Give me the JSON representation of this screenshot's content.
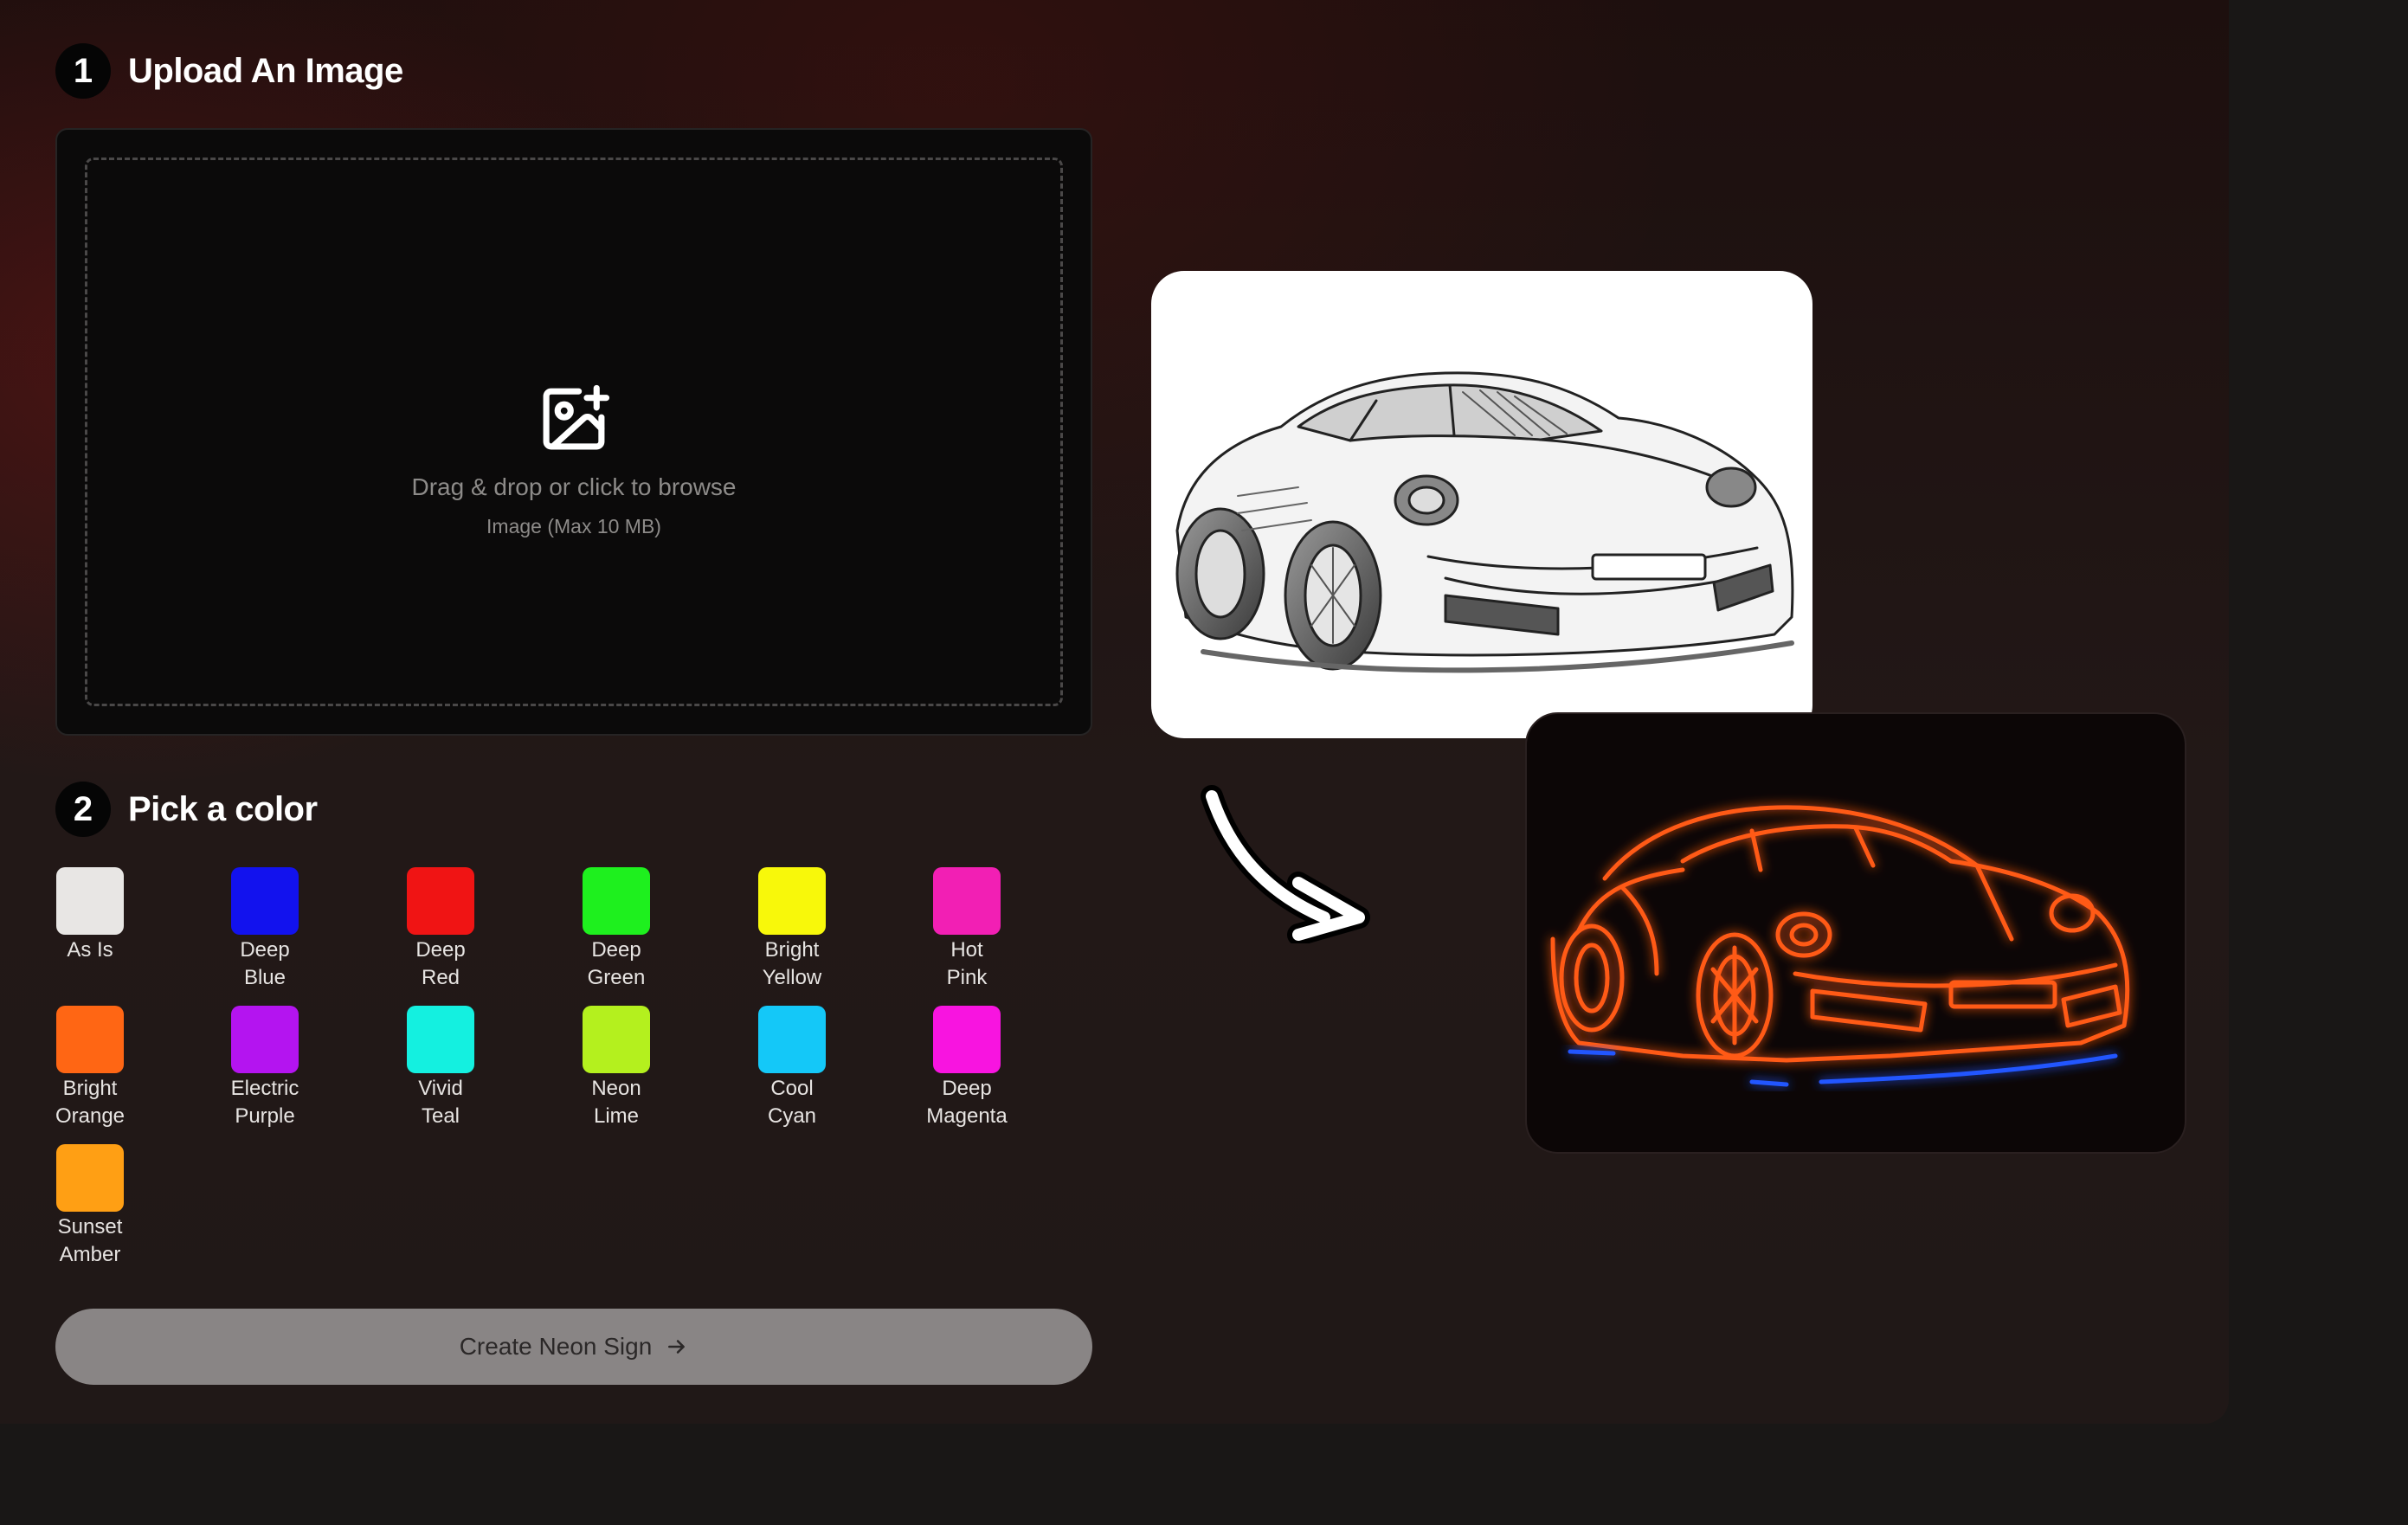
{
  "step1": {
    "number": "1",
    "title": "Upload An Image"
  },
  "upload": {
    "prompt": "Drag & drop or click to browse",
    "hint": "Image (Max 10 MB)",
    "icon": "image-plus-icon"
  },
  "step2": {
    "number": "2",
    "title": "Pick a color"
  },
  "colors": [
    {
      "label": "As Is",
      "hex": "#e8e6e4"
    },
    {
      "label": "Deep\nBlue",
      "hex": "#1212ee"
    },
    {
      "label": "Deep\nRed",
      "hex": "#f01414"
    },
    {
      "label": "Deep\nGreen",
      "hex": "#1ef01e"
    },
    {
      "label": "Bright\nYellow",
      "hex": "#f8f80a"
    },
    {
      "label": "Hot\nPink",
      "hex": "#f21fb4"
    },
    {
      "label": "Bright\nOrange",
      "hex": "#ff6614"
    },
    {
      "label": "Electric\nPurple",
      "hex": "#b414f0"
    },
    {
      "label": "Vivid\nTeal",
      "hex": "#14f0e0"
    },
    {
      "label": "Neon\nLime",
      "hex": "#b4f01e"
    },
    {
      "label": "Cool\nCyan",
      "hex": "#14c8f8"
    },
    {
      "label": "Deep\nMagenta",
      "hex": "#f814e0"
    },
    {
      "label": "Sunset\nAmber",
      "hex": "#ff9f14"
    }
  ],
  "cta": {
    "label": "Create Neon Sign",
    "icon": "arrow-right-icon"
  },
  "preview": {
    "before_image": "pencil-sketch-sports-car",
    "after_image": "neon-sign-sports-car",
    "arrow_icon": "curved-arrow-icon"
  }
}
